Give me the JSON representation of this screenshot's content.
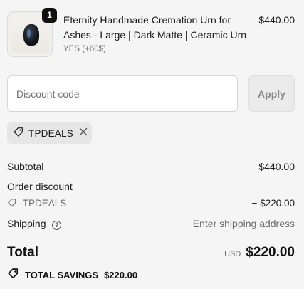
{
  "product": {
    "quantity": "1",
    "title": "Eternity Handmade Cremation Urn for Ashes - Large | Dark Matte | Ceramic Urn",
    "variant": "YES (+60$)",
    "price": "$440.00"
  },
  "discount": {
    "placeholder": "Discount code",
    "apply_label": "Apply",
    "applied_code": "TPDEALS",
    "remove_icon": "close-icon"
  },
  "summary": {
    "subtotal_label": "Subtotal",
    "subtotal_value": "$440.00",
    "order_discount_label": "Order discount",
    "discount_code": "TPDEALS",
    "discount_value": "− $220.00",
    "shipping_label": "Shipping",
    "shipping_value": "Enter shipping address",
    "total_label": "Total",
    "currency": "USD",
    "total_value": "$220.00",
    "savings_label": "TOTAL SAVINGS",
    "savings_value": "$220.00"
  },
  "colors": {
    "background": "#f5f5f5",
    "text": "#1a1a1a",
    "muted": "#6b6b6b",
    "badge": "#111111"
  }
}
